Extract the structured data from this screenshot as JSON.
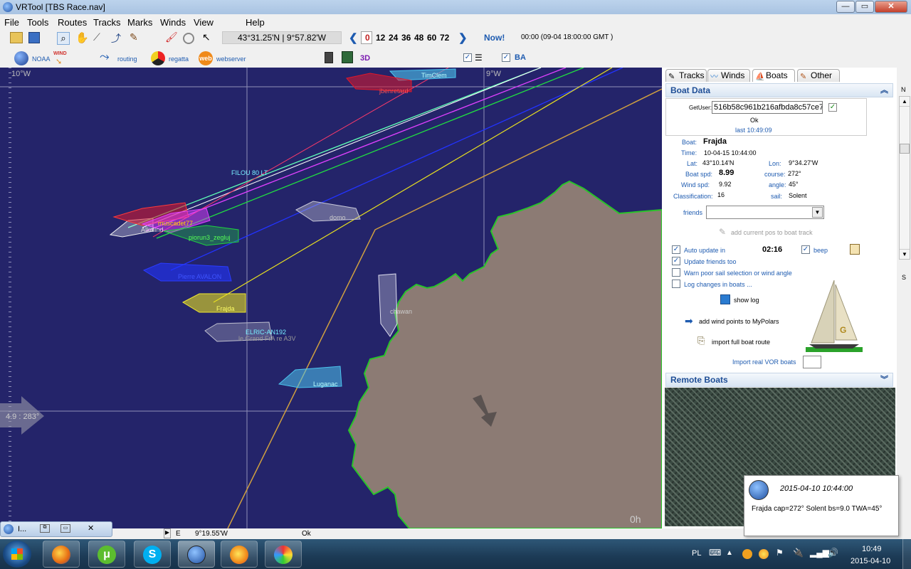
{
  "window": {
    "title": "VRTool [TBS Race.nav]",
    "min": "—",
    "max": "▭",
    "close": "✕"
  },
  "menu": [
    "File",
    "Tools",
    "Routes",
    "Tracks",
    "Marks",
    "Winds",
    "View",
    "Help"
  ],
  "toolbar": {
    "position": "43°31.25'N | 9°57.82'W",
    "hours": [
      "0",
      "12",
      "24",
      "36",
      "48",
      "60",
      "72"
    ],
    "now": "Now!",
    "time": "00:00 (09-04 18:00:00 GMT )",
    "noaa": "NOAA",
    "wind": "WIND",
    "routing": "routing",
    "regatta": "regatta",
    "web": "web",
    "webserver": "webserver",
    "three_d": "3D",
    "ba": "BA"
  },
  "map": {
    "grid_labels": [
      "10°W",
      "9°W"
    ],
    "wind_arrow": "4.9 : 283°",
    "time_label": "0h",
    "boats": [
      "TimClem",
      "jbenretard",
      "FILOU 80 LT",
      "muscadet77",
      "Alkalind",
      "piorun3_zegluj",
      "domo",
      "Pierre AVALON",
      "Frajda",
      "ELRIC-AN192",
      "le Grand FrA re A3V",
      "chawan",
      "Luganac"
    ],
    "colors": {
      "sea": "#24246a",
      "land": "#8c7b74",
      "coast": "#29c429"
    }
  },
  "tabs": [
    "Tracks",
    "Winds",
    "Boats",
    "Other"
  ],
  "boat_data": {
    "header": "Boat Data",
    "getuser_label": "GetUser:",
    "getuser_value": "516b58c961b216afbda8c57ce7",
    "ok": "Ok",
    "last": "last 10:49:09",
    "boat_label": "Boat:",
    "boat": "Frajda",
    "time_label": "Time:",
    "time": "10-04-15 10:44:00",
    "lat_label": "Lat:",
    "lat": "43°10.14'N",
    "lon_label": "Lon:",
    "lon": "9°34.27'W",
    "spd_label": "Boat spd:",
    "spd": "8.99",
    "course_label": "course:",
    "course": "272°",
    "wind_label": "Wind    spd:",
    "wind": "9.92",
    "angle_label": "angle:",
    "angle": "45°",
    "class_label": "Classification:",
    "class": "16",
    "sail_label": "sail:",
    "sail": "Solent",
    "friends_label": "friends",
    "add_pos": "add current pos to boat track",
    "auto_update": "Auto update in",
    "countdown": "02:16",
    "beep": "beep",
    "update_friends": "Update friends too",
    "warn": "Warn poor sail selection or wind angle",
    "log_changes": "Log changes in boats ...",
    "show_log": "show log",
    "add_wind": "add wind points to MyPolars",
    "import_route": "import full boat route",
    "import_vor": "Import real VOR boats"
  },
  "remote": {
    "header": "Remote Boats"
  },
  "scroll": {
    "n": "N",
    "s": "S"
  },
  "status": {
    "e": "E",
    "lon": "9°19.55'W",
    "ok": "Ok"
  },
  "notification": {
    "time": "2015-04-10 10:44:00",
    "text": "Frajda cap=272° Solent bs=9.0 TWA=45°"
  },
  "minimized": {
    "label": "I..."
  },
  "tray": {
    "lang": "PL",
    "clock_time": "10:49",
    "clock_date": "2015-04-10"
  }
}
